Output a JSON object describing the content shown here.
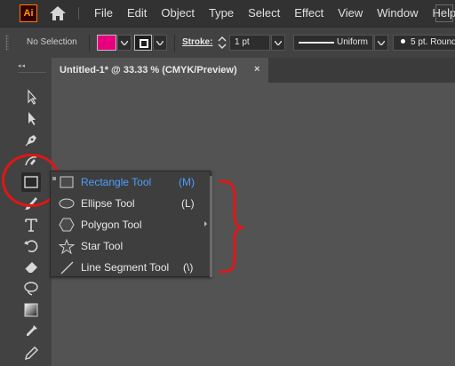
{
  "app": {
    "logo_text": "Ai"
  },
  "menu": {
    "items": [
      "File",
      "Edit",
      "Object",
      "Type",
      "Select",
      "Effect",
      "View",
      "Window",
      "Help"
    ]
  },
  "control_bar": {
    "selection_label": "No Selection",
    "fill_color": "#e6007e",
    "stroke_label": "Stroke:",
    "stroke_weight": "1 pt",
    "profile_label": "Uniform",
    "brush_label": "5 pt. Round"
  },
  "document_tab": {
    "title": "Untitled-1* @ 33.33 % (CMYK/Preview)",
    "close_glyph": "×"
  },
  "toolbar": {
    "tools": [
      "selection-tool",
      "direct-selection-tool",
      "pen-tool",
      "curvature-tool",
      "rectangle-tool",
      "paintbrush-tool",
      "type-tool",
      "rotate-tool",
      "eraser-tool",
      "lasso-tool",
      "gradient-tool",
      "eyedropper-tool",
      "eyedropper-tool-2"
    ]
  },
  "flyout": {
    "items": [
      {
        "label": "Rectangle Tool",
        "shortcut": "(M)",
        "icon": "rectangle-icon",
        "active": true
      },
      {
        "label": "Ellipse Tool",
        "shortcut": "(L)",
        "icon": "ellipse-icon",
        "active": false
      },
      {
        "label": "Polygon Tool",
        "shortcut": "",
        "icon": "polygon-icon",
        "active": false
      },
      {
        "label": "Star Tool",
        "shortcut": "",
        "icon": "star-icon",
        "active": false
      },
      {
        "label": "Line Segment Tool",
        "shortcut": "(\\)",
        "icon": "line-icon",
        "active": false
      }
    ]
  },
  "colors": {
    "accent_active": "#4d9eff",
    "annotation": "#e01616"
  }
}
